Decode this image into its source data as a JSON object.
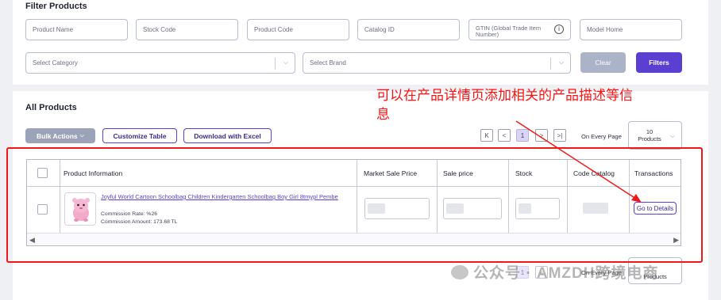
{
  "filter": {
    "title": "Filter Products",
    "product_name_placeholder": "Product Name",
    "stock_code_placeholder": "Stock Code",
    "product_code_placeholder": "Product Code",
    "catalog_id_placeholder": "Catalog ID",
    "gtin_placeholder": "GTIN (Global Trade Item Number)",
    "model_home_placeholder": "Model Home",
    "category_placeholder": "Select Category",
    "brand_placeholder": "Select Brand",
    "clear_label": "Clear",
    "filters_label": "Filters"
  },
  "products": {
    "title": "All Products",
    "bulk_actions_label": "Bulk Actions",
    "customize_table_label": "Customize Table",
    "download_excel_label": "Download with Excel",
    "pagination": {
      "first": "K",
      "prev": "<",
      "current": "1",
      "next": ">",
      "last": ">|"
    },
    "on_every_page_label": "On Every Page",
    "per_page_value": "10",
    "per_page_unit": "Products",
    "columns": [
      "Product Information",
      "Market Sale Price",
      "Sale price",
      "Stock",
      "Code Catalog",
      "Transactions"
    ],
    "row": {
      "product_title": "Joyful World Cartoon Schoolbag Children Kindergarten Schoolbag Boy Girl 8tmypl Pembe",
      "commission_rate": "Commission Rate: %26",
      "commission_amount": "Commission Amount: 173.68 TL",
      "action_label": "Go to Details"
    },
    "bottom_on_every_page_label": "On Every Page",
    "bottom_per_page_unit": "Products"
  },
  "annotation": {
    "text_line1": "可以在产品详情页添加相关的产品描述等信",
    "text_line2": "息",
    "color": "#f21818"
  },
  "watermark": {
    "text": "公众号 · AMZDH跨境电商"
  },
  "colors": {
    "accent": "#5b3fd0",
    "annotation": "#f21818",
    "clear_button": "#aab3c7",
    "bulk_button": "#9aa3b8"
  }
}
